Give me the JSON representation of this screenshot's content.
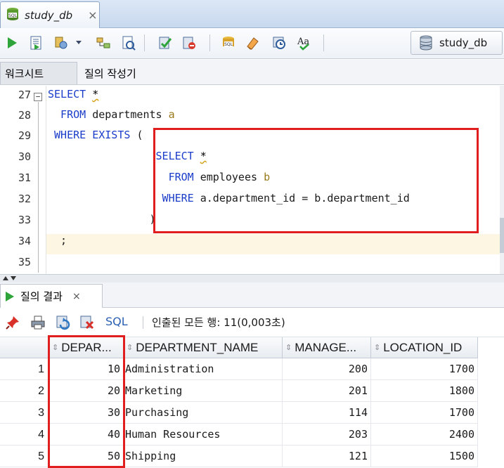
{
  "document_tab": {
    "label": "study_db",
    "close": "×",
    "icon": "sql-worksheet-icon"
  },
  "toolbar": {
    "buttons": [
      "run-statement",
      "run-script",
      "autotrace",
      "dropdown",
      "explain-plan",
      "sql-tuning",
      "commit",
      "rollback",
      "unshared-sql",
      "clear",
      "sql-history",
      "to-upper-lower"
    ],
    "connection_label": "study_db"
  },
  "subtabs": [
    "워크시트",
    "질의 작성기"
  ],
  "editor": {
    "line_numbers": [
      "27",
      "28",
      "29",
      "30",
      "31",
      "32",
      "33",
      "34",
      "35"
    ],
    "lines": [
      [
        {
          "t": "SELECT ",
          "c": "kw"
        },
        {
          "t": "*",
          "c": "squig"
        }
      ],
      [
        {
          "t": "  FROM ",
          "c": "kw"
        },
        {
          "t": "departments ",
          "c": "id"
        },
        {
          "t": "a",
          "c": "al"
        }
      ],
      [
        {
          "t": " WHERE EXISTS ",
          "c": "kw"
        },
        {
          "t": "(",
          "c": "id"
        }
      ],
      [
        {
          "t": "                 SELECT ",
          "c": "kw"
        },
        {
          "t": "*",
          "c": "squig"
        }
      ],
      [
        {
          "t": "                   FROM ",
          "c": "kw"
        },
        {
          "t": "employees ",
          "c": "id"
        },
        {
          "t": "b",
          "c": "al"
        }
      ],
      [
        {
          "t": "                  WHERE ",
          "c": "kw"
        },
        {
          "t": "a.department_id = b.department_id",
          "c": "id"
        }
      ],
      [
        {
          "t": "                ",
          "c": "id"
        },
        {
          "t": ")",
          "c": "id"
        }
      ],
      [
        {
          "t": "  ;",
          "c": "id"
        }
      ],
      [
        {
          "t": "",
          "c": "id"
        }
      ]
    ]
  },
  "result": {
    "tab_label": "질의 결과",
    "tab_close": "×",
    "sql_label": "SQL",
    "status": "인출된 모든 행: 11(0,003초)",
    "columns": [
      "DEPAR...",
      "DEPARTMENT_NAME",
      "MANAGE...",
      "LOCATION_ID"
    ],
    "rows": [
      {
        "n": "1",
        "dept": "10",
        "name": "Administration",
        "mgr": "200",
        "loc": "1700"
      },
      {
        "n": "2",
        "dept": "20",
        "name": "Marketing",
        "mgr": "201",
        "loc": "1800"
      },
      {
        "n": "3",
        "dept": "30",
        "name": "Purchasing",
        "mgr": "114",
        "loc": "1700"
      },
      {
        "n": "4",
        "dept": "40",
        "name": "Human Resources",
        "mgr": "203",
        "loc": "2400"
      },
      {
        "n": "5",
        "dept": "50",
        "name": "Shipping",
        "mgr": "121",
        "loc": "1500"
      }
    ]
  },
  "colors": {
    "keyword": "#1a3cc9",
    "highlight": "#e01e1e",
    "alias": "#9a7a1a"
  }
}
